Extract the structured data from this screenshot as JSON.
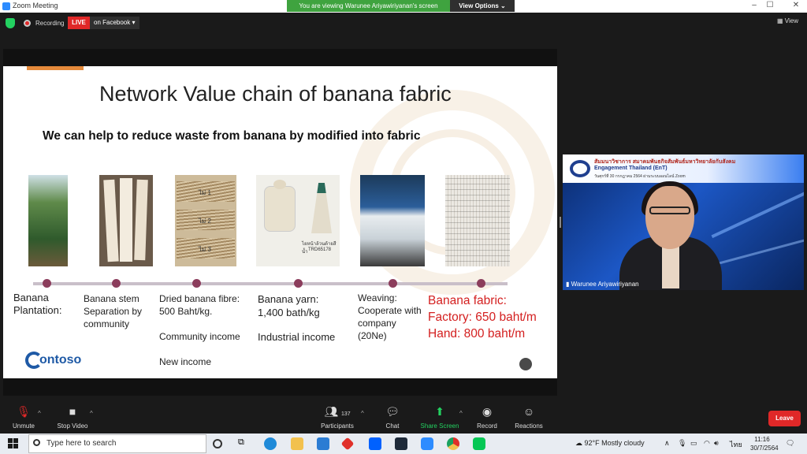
{
  "window": {
    "title": "Zoom Meeting"
  },
  "share_banner": {
    "viewing_text": "You are viewing Warunee Ariyawiriyanan's screen",
    "view_options": "View Options"
  },
  "topbar": {
    "recording_label": "Recording",
    "live_badge": "LIVE",
    "live_target": "on Facebook",
    "view_label": "View"
  },
  "slide": {
    "title": "Network Value chain of banana fabric",
    "subtitle": "We can help to reduce waste from banana by modified into fabric",
    "stages": [
      {
        "lines": [
          "Banana",
          "Plantation:"
        ]
      },
      {
        "lines": [
          "Banana stem",
          "Separation by",
          "community"
        ]
      },
      {
        "lines": [
          "Dried banana fibre:",
          "500 Baht/kg.",
          "Community income",
          "New income"
        ]
      },
      {
        "lines": [
          "Banana yarn:",
          "1,400 bath/kg",
          "Industrial income"
        ]
      },
      {
        "lines": [
          "Weaving:",
          "Cooperate with",
          "company",
          "(20Ne)"
        ]
      },
      {
        "lines": [
          "Banana fabric:",
          "Factory: 650 baht/m",
          "Hand: 800 baht/m"
        ],
        "color": "#d42020"
      }
    ],
    "fibre_labels": [
      "ไม่ 1",
      "ไม่ 2",
      "ไม่ 3"
    ],
    "yarn_label": [
      "ไยหน้าล้วนด้ายสีน้ำ",
      "TRD65178"
    ],
    "logo": "ontoso",
    "colors": {
      "accent": "#e58a3b",
      "timeline_dot": "#8b3d5c",
      "highlight": "#d42020"
    }
  },
  "video": {
    "banner_line1": "สัมมนาวิชาการ สมาคมพันธกิจสัมพันธ์มหาวิทยาลัยกับสังคม",
    "banner_line2": "Engagement Thailand (EnT)",
    "banner_line3": "วันศุกร์ที่ 30 กรกฎาคม 2564 ผ่านระบบออนไลน์ Zoom",
    "participant_name": "Warunee Ariyawiriyanan"
  },
  "controls": {
    "unmute": "Unmute",
    "stop_video": "Stop Video",
    "participants": "Participants",
    "participants_count": "137",
    "chat": "Chat",
    "share_screen": "Share Screen",
    "record": "Record",
    "reactions": "Reactions",
    "leave": "Leave"
  },
  "taskbar": {
    "search_placeholder": "Type here to search",
    "weather": "92°F  Mostly cloudy",
    "lang": "ไทย",
    "time": "11:16",
    "date": "30/7/2564"
  }
}
